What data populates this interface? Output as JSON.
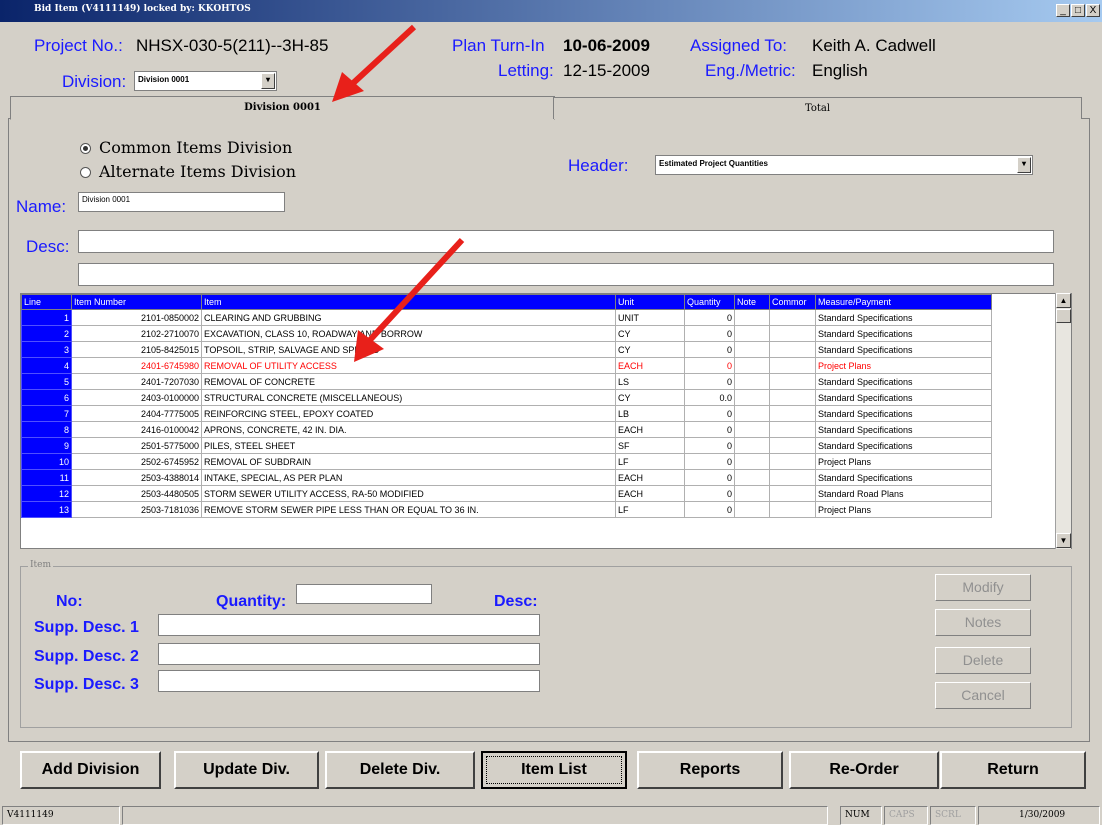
{
  "window": {
    "title": "Bid Item (V4111149) locked by: KKOHTOS",
    "controls": [
      "_",
      "□",
      "X"
    ]
  },
  "header": {
    "project_label": "Project No.:",
    "project_value": "NHSX-030-5(211)--3H-85",
    "division_label": "Division:",
    "division_value": "Division 0001",
    "plan_label": "Plan Turn-In",
    "plan_value": "10-06-2009",
    "letting_label": "Letting:",
    "letting_value": "12-15-2009",
    "assigned_label": "Assigned To:",
    "assigned_value": "Keith A. Cadwell",
    "engmetric_label": "Eng./Metric:",
    "engmetric_value": "English"
  },
  "tabs": [
    {
      "label": "Division 0001",
      "active": true
    },
    {
      "label": "Total",
      "active": false
    }
  ],
  "form": {
    "radio_common": "Common Items Division",
    "radio_alternate": "Alternate Items Division",
    "selected_radio": "common",
    "header_label": "Header:",
    "header_value": "Estimated Project Quantities",
    "name_label": "Name:",
    "name_value": "Division 0001",
    "desc_label": "Desc:",
    "desc_value": "",
    "desc2_value": ""
  },
  "grid": {
    "columns": [
      "Line",
      "Item Number",
      "Item",
      "Unit",
      "Quantity",
      "Note",
      "Commor",
      "Measure/Payment"
    ],
    "rows": [
      {
        "line": "1",
        "number": "2101-0850002",
        "item": "CLEARING AND GRUBBING",
        "unit": "UNIT",
        "qty": "0",
        "note": "",
        "common": "",
        "measure": "Standard Specifications",
        "highlight": false
      },
      {
        "line": "2",
        "number": "2102-2710070",
        "item": "EXCAVATION, CLASS 10, ROADWAY AND BORROW",
        "unit": "CY",
        "qty": "0",
        "note": "",
        "common": "",
        "measure": "Standard Specifications",
        "highlight": false
      },
      {
        "line": "3",
        "number": "2105-8425015",
        "item": "TOPSOIL, STRIP, SALVAGE AND SPREAD",
        "unit": "CY",
        "qty": "0",
        "note": "",
        "common": "",
        "measure": "Standard Specifications",
        "highlight": false
      },
      {
        "line": "4",
        "number": "2401-6745980",
        "item": "REMOVAL OF UTILITY ACCESS",
        "unit": "EACH",
        "qty": "0",
        "note": "",
        "common": "",
        "measure": "Project Plans",
        "highlight": true
      },
      {
        "line": "5",
        "number": "2401-7207030",
        "item": "REMOVAL OF CONCRETE",
        "unit": "LS",
        "qty": "0",
        "note": "",
        "common": "",
        "measure": "Standard Specifications",
        "highlight": false
      },
      {
        "line": "6",
        "number": "2403-0100000",
        "item": "STRUCTURAL CONCRETE (MISCELLANEOUS)",
        "unit": "CY",
        "qty": "0.0",
        "note": "",
        "common": "",
        "measure": "Standard Specifications",
        "highlight": false
      },
      {
        "line": "7",
        "number": "2404-7775005",
        "item": "REINFORCING STEEL, EPOXY COATED",
        "unit": "LB",
        "qty": "0",
        "note": "",
        "common": "",
        "measure": "Standard Specifications",
        "highlight": false
      },
      {
        "line": "8",
        "number": "2416-0100042",
        "item": "APRONS, CONCRETE, 42 IN. DIA.",
        "unit": "EACH",
        "qty": "0",
        "note": "",
        "common": "",
        "measure": "Standard Specifications",
        "highlight": false
      },
      {
        "line": "9",
        "number": "2501-5775000",
        "item": "PILES, STEEL SHEET",
        "unit": "SF",
        "qty": "0",
        "note": "",
        "common": "",
        "measure": "Standard Specifications",
        "highlight": false
      },
      {
        "line": "10",
        "number": "2502-6745952",
        "item": "REMOVAL OF SUBDRAIN",
        "unit": "LF",
        "qty": "0",
        "note": "",
        "common": "",
        "measure": "Project Plans",
        "highlight": false
      },
      {
        "line": "11",
        "number": "2503-4388014",
        "item": "INTAKE, SPECIAL, AS PER PLAN",
        "unit": "EACH",
        "qty": "0",
        "note": "",
        "common": "",
        "measure": "Standard Specifications",
        "highlight": false
      },
      {
        "line": "12",
        "number": "2503-4480505",
        "item": "STORM SEWER UTILITY ACCESS, RA-50 MODIFIED",
        "unit": "EACH",
        "qty": "0",
        "note": "",
        "common": "",
        "measure": "Standard Road Plans",
        "highlight": false
      },
      {
        "line": "13",
        "number": "2503-7181036",
        "item": "REMOVE STORM SEWER PIPE LESS THAN OR EQUAL TO 36 IN.",
        "unit": "LF",
        "qty": "0",
        "note": "",
        "common": "",
        "measure": "Project Plans",
        "highlight": false
      }
    ]
  },
  "item_panel": {
    "group_label": "Item",
    "no_label": "No:",
    "quantity_label": "Quantity:",
    "desc_label": "Desc:",
    "supp1_label": "Supp. Desc. 1",
    "supp2_label": "Supp. Desc. 2",
    "supp3_label": "Supp. Desc. 3",
    "modify": "Modify",
    "notes": "Notes",
    "delete": "Delete",
    "cancel": "Cancel"
  },
  "bottom_buttons": [
    "Add Division",
    "Update Div.",
    "Delete Div.",
    "Item List",
    "Reports",
    "Re-Order",
    "Return"
  ],
  "statusbar": {
    "id": "V4111149",
    "num": "NUM",
    "caps": "CAPS",
    "scrl": "SCRL",
    "date": "1/30/2009"
  },
  "colors": {
    "accent_blue": "#1a1aff",
    "grid_header": "#0000ff",
    "highlight_row": "#ff0000",
    "annotation_arrow": "#e8201a"
  }
}
